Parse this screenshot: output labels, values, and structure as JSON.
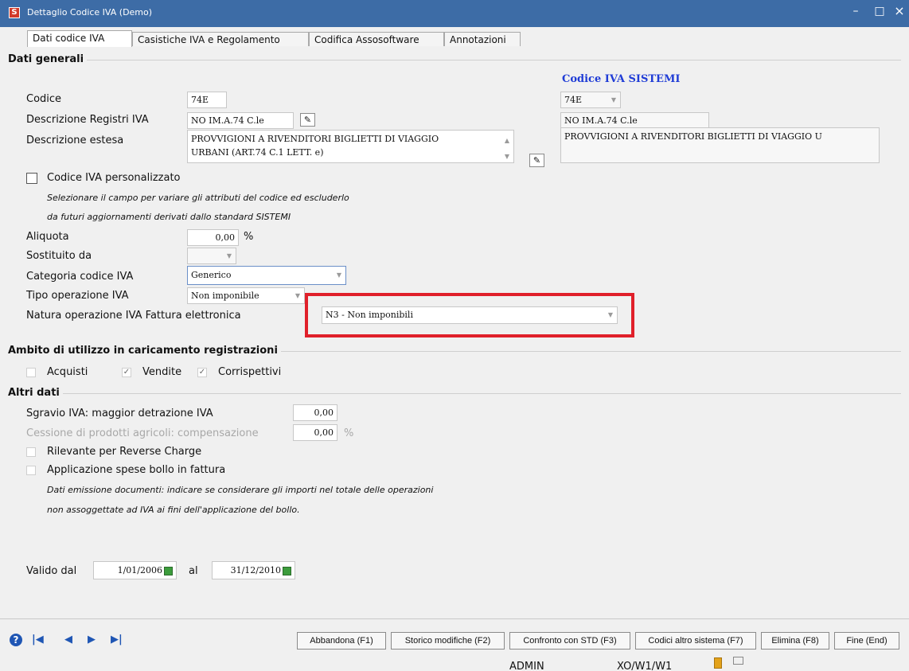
{
  "window": {
    "title": "Dettaglio Codice IVA  (Demo)",
    "minimize": "–",
    "maximize": "□",
    "close": "×",
    "app_icon_glyph": "S",
    "title_bg_color": "#3d6ca6"
  },
  "tabs": [
    "Dati codice IVA",
    "Casistiche IVA e Regolamento",
    "Codifica Assosoftware",
    "Annotazioni"
  ],
  "dati_generali": {
    "section_title": "Dati generali",
    "sistemi_title": "Codice IVA SISTEMI",
    "codice_label": "Codice",
    "codice_value": "74E",
    "sistemi_codice": "74E",
    "desc_registri_label": "Descrizione Registri IVA",
    "desc_registri_value": "NO IM.A.74 C.le",
    "sistemi_desc_registri": "NO IM.A.74 C.le",
    "desc_estesa_label": "Descrizione estesa",
    "desc_estesa_value": "PROVVIGIONI A RIVENDITORI BIGLIETTI DI VIAGGIO\nURBANI (ART.74 C.1 LETT. e)",
    "sistemi_desc_estesa": "PROVVIGIONI A RIVENDITORI BIGLIETTI DI VIAGGIO U",
    "personalizzato_label": "Codice IVA personalizzato",
    "personalizzato_hint1": "Selezionare il campo per variare gli attributi del codice ed escluderlo",
    "personalizzato_hint2": "da futuri aggiornamenti derivati dallo standard SISTEMI",
    "aliquota_label": "Aliquota",
    "aliquota_value": "0,00",
    "aliquota_unit": "%",
    "sostituito_label": "Sostituito da",
    "sostituito_value": "",
    "categoria_label": "Categoria codice IVA",
    "categoria_value": "Generico",
    "tipo_label": "Tipo operazione IVA",
    "tipo_value": "Non imponibile",
    "natura_label": "Natura operazione IVA Fattura elettronica",
    "natura_value": "N3 - Non imponibili",
    "highlight_color": "#e0202a"
  },
  "ambito": {
    "section_title": "Ambito di utilizzo in caricamento registrazioni",
    "acquisti": "Acquisti",
    "vendite": "Vendite",
    "corrispettivi": "Corrispettivi",
    "acquisti_checked": false,
    "vendite_checked": true,
    "corrispettivi_checked": true
  },
  "altri": {
    "section_title": "Altri dati",
    "sgravio_label": "Sgravio IVA: maggior detrazione IVA",
    "sgravio_value": "0,00",
    "cessione_label": "Cessione di prodotti agricoli: compensazione",
    "cessione_value": "0,00",
    "cessione_unit": "%",
    "reverse_label": "Rilevante per Reverse Charge",
    "bollo_label": "Applicazione spese bollo in fattura",
    "bollo_hint1": "Dati emissione documenti: indicare se considerare gli importi nel totale delle operazioni",
    "bollo_hint2": "non assoggettate ad IVA ai fini dell'applicazione del bollo."
  },
  "validita": {
    "dal_label": "Valido dal",
    "dal_value": "1/01/2006",
    "al_label": "al",
    "al_value": "31/12/2010"
  },
  "footer": {
    "nav": [
      "?",
      "|◀",
      "◀",
      "▶",
      "▶|"
    ],
    "buttons": [
      "Abbandona (F1)",
      "Storico modifiche (F2)",
      "Confronto con STD (F3)",
      "Codici altro sistema (F7)",
      "Elimina (F8)",
      "Fine (End)"
    ],
    "status_user": "ADMIN",
    "status_terminal": "XO/W1/W1",
    "status_icon1": "battery-icon",
    "status_icon2": "monitor-icon"
  }
}
